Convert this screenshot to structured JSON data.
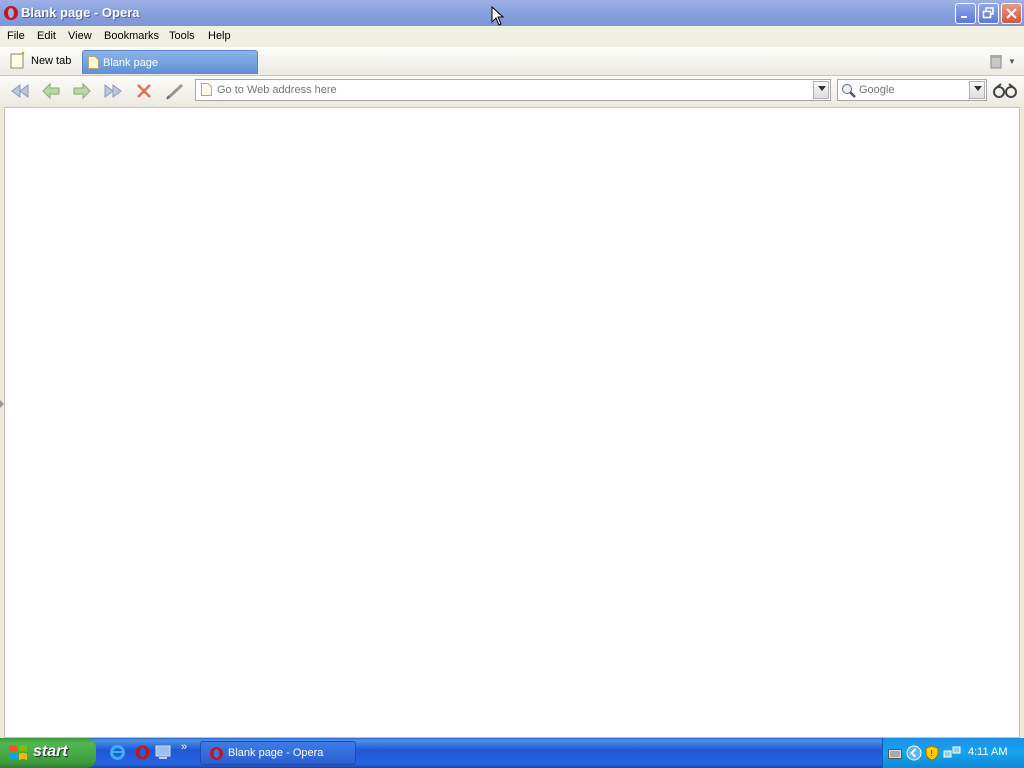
{
  "window": {
    "title": "Blank page - Opera",
    "app_icon": "opera-logo-icon",
    "controls": [
      "minimize-icon",
      "restore-icon",
      "close-icon"
    ]
  },
  "menu": {
    "items": [
      "File",
      "Edit",
      "View",
      "Bookmarks",
      "Tools",
      "Help"
    ]
  },
  "tabs": {
    "new_tab_label": "New tab",
    "active_tab_label": "Blank page"
  },
  "toolbar": {
    "icons": [
      "rewind-icon",
      "back-icon",
      "forward-icon",
      "fast-forward-icon",
      "stop-icon",
      "edit-pen-icon"
    ],
    "address_placeholder": "Go to Web address here",
    "search_placeholder": "Google",
    "binoculars_icon": "binoculars-icon"
  },
  "taskbar": {
    "start_label": "start",
    "quick_launch": [
      "internet-explorer-icon",
      "opera-icon",
      "show-desktop-icon"
    ],
    "task_label": "Blank page - Opera",
    "tray_icons": [
      "keyboard-icon",
      "collapse-tray-icon",
      "security-shield-icon",
      "network-icon"
    ],
    "clock": "4:11 AM"
  },
  "colors": {
    "title_bar": "#8AA1DF",
    "tab_active": "#5D8FD6",
    "taskbar": "#2157D7",
    "start_button": "#3F9E3F",
    "tray": "#16A4EF"
  }
}
